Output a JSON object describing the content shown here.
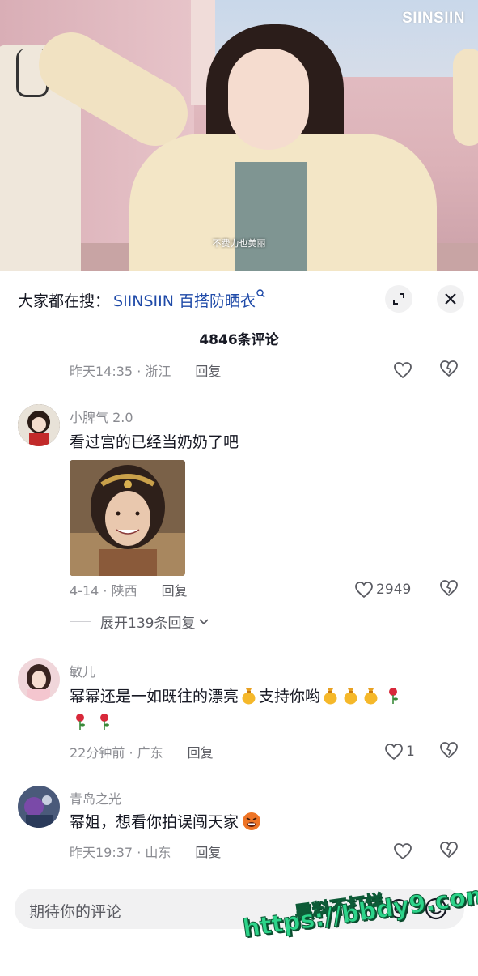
{
  "video": {
    "brand_logo": "SIINSIIN",
    "subtitle": "不费力也美丽"
  },
  "sheet": {
    "search_prefix": "大家都在搜：",
    "search_term": "SIINSIIN 百搭防晒衣",
    "search_icon": "search-icon",
    "expand_icon": "fullscreen-icon",
    "close_icon": "close-icon",
    "comment_count": "4846条评论"
  },
  "comments": [
    {
      "meta": "昨天14:35 · 浙江",
      "reply": "回复",
      "likes": ""
    },
    {
      "user": "小脾气 2.0",
      "text": "看过宫的已经当奶奶了吧",
      "has_image": true,
      "meta": "4-14 · 陕西",
      "reply": "回复",
      "likes": "2949",
      "expand": "展开139条回复"
    },
    {
      "user": "敏儿",
      "text_a": "幂幂还是一如既往的漂亮",
      "text_b": "支持你哟",
      "meta": "22分钟前 · 广东",
      "reply": "回复",
      "likes": "1"
    },
    {
      "user": "青岛之光",
      "text": "幂姐，想看你拍误闯天家",
      "meta": "昨天19:37 · 山东",
      "reply": "回复",
      "likes": ""
    }
  ],
  "input": {
    "placeholder": "期待你的评论"
  },
  "watermark": {
    "line1": "黑料不打烊",
    "line2": "https://bbdy9.com"
  },
  "colors": {
    "search_link": "#1f4aa8",
    "watermark": "#2dd48a"
  }
}
